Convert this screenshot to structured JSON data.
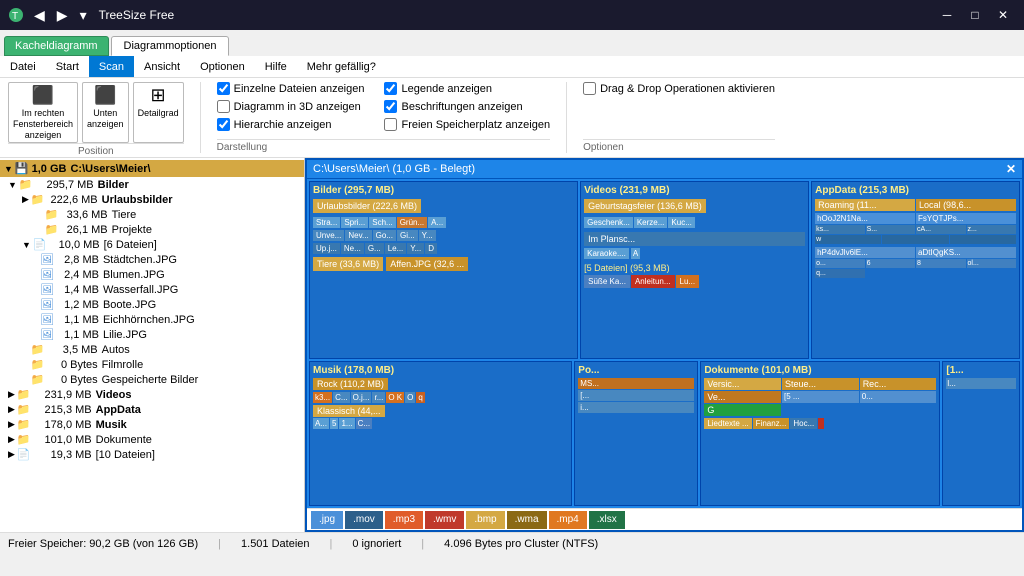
{
  "titlebar": {
    "title": "TreeSize Free",
    "back_btn": "◀",
    "forward_btn": "▶",
    "pin_btn": "📌",
    "minimize": "─",
    "maximize": "□",
    "close": "✕"
  },
  "tabs": {
    "kachel_label": "Kacheldiagramm",
    "diagramm_label": "Diagrammoptionen"
  },
  "menu": {
    "items": [
      "Datei",
      "Start",
      "Scan",
      "Ansicht",
      "Optionen",
      "Hilfe",
      "Mehr gefällig?"
    ]
  },
  "ribbon": {
    "darstellung_title": "Darstellung",
    "optionen_title": "Optionen",
    "position_title": "Position",
    "checkboxes_left": [
      {
        "label": "Einzelne Dateien anzeigen",
        "checked": true
      },
      {
        "label": "Diagramm in 3D anzeigen",
        "checked": false
      },
      {
        "label": "Hierarchie anzeigen",
        "checked": true
      }
    ],
    "checkboxes_right": [
      {
        "label": "Legende anzeigen",
        "checked": true
      },
      {
        "label": "Beschriftungen anzeigen",
        "checked": true
      },
      {
        "label": "Freien Speicherplatz anzeigen",
        "checked": false
      }
    ],
    "opt_checkbox": "Drag & Drop Operationen aktivieren",
    "btn_position1": "Im rechten\nFensterbereich\nanzeigen",
    "btn_position2": "Unten\nanzeigen",
    "btn_detail": "Detailgrad"
  },
  "tree": {
    "root_size": "1,0 GB",
    "root_path": "C:\\Users\\Meier\\",
    "items": [
      {
        "indent": 1,
        "size": "295,7 MB",
        "name": "Bilder",
        "bold": true,
        "has_children": true,
        "expanded": true
      },
      {
        "indent": 2,
        "size": "222,6 MB",
        "name": "Urlaubsbilder",
        "bold": true,
        "has_children": true,
        "expanded": false
      },
      {
        "indent": 3,
        "size": "33,6 MB",
        "name": "Tiere",
        "bold": false
      },
      {
        "indent": 3,
        "size": "26,1 MB",
        "name": "Projekte",
        "bold": false
      },
      {
        "indent": 2,
        "size": "10,0 MB",
        "name": "[6 Dateien]",
        "bold": false,
        "expanded": true,
        "has_children": true
      },
      {
        "indent": 3,
        "size": "2,8 MB",
        "name": "Städtchen.JPG",
        "is_file": true
      },
      {
        "indent": 3,
        "size": "2,4 MB",
        "name": "Blumen.JPG",
        "is_file": true
      },
      {
        "indent": 3,
        "size": "1,4 MB",
        "name": "Wasserfall.JPG",
        "is_file": true
      },
      {
        "indent": 3,
        "size": "1,2 MB",
        "name": "Boote.JPG",
        "is_file": true
      },
      {
        "indent": 3,
        "size": "1,1 MB",
        "name": "Eichhörnchen.JPG",
        "is_file": true
      },
      {
        "indent": 3,
        "size": "1,1 MB",
        "name": "Lilie.JPG",
        "is_file": true
      },
      {
        "indent": 2,
        "size": "3,5 MB",
        "name": "Autos",
        "bold": false
      },
      {
        "indent": 2,
        "size": "0 Bytes",
        "name": "Filmrolle",
        "bold": false
      },
      {
        "indent": 2,
        "size": "0 Bytes",
        "name": "Gespeicherte Bilder",
        "bold": false
      },
      {
        "indent": 1,
        "size": "231,9 MB",
        "name": "Videos",
        "bold": true
      },
      {
        "indent": 1,
        "size": "215,3 MB",
        "name": "AppData",
        "bold": true
      },
      {
        "indent": 1,
        "size": "178,0 MB",
        "name": "Musik",
        "bold": true
      },
      {
        "indent": 1,
        "size": "101,0 MB",
        "name": "Dokumente",
        "bold": false
      },
      {
        "indent": 1,
        "size": "19,3 MB",
        "name": "[10 Dateien]",
        "bold": false
      }
    ]
  },
  "tile_header": "C:\\Users\\Meier\\ (1,0 GB - Belegt)",
  "tile_sections": {
    "bilder": {
      "title": "Bilder (295,7 MB)",
      "sub": "Urlaubsbilder (222,6 MB)"
    },
    "videos": {
      "title": "Videos (231,9 MB)",
      "sub": "Geburtstagsfeier (136,6 MB)"
    },
    "appdata": {
      "title": "AppData (215,3 MB)"
    },
    "musik": {
      "title": "Musik (178,0 MB)",
      "sub": "Rock (110,2 MB)"
    },
    "dokumente": {
      "title": "Dokumente (101,0 MB)"
    }
  },
  "legend": {
    "items": [
      {
        "ext": ".jpg",
        "class": "legend-jpg"
      },
      {
        "ext": ".mov",
        "class": "legend-mov"
      },
      {
        "ext": ".mp3",
        "class": "legend-mp3"
      },
      {
        "ext": ".wmv",
        "class": "legend-wmv"
      },
      {
        "ext": ".bmp",
        "class": "legend-bmp"
      },
      {
        "ext": ".wma",
        "class": "legend-wma"
      },
      {
        "ext": ".mp4",
        "class": "legend-mp4"
      },
      {
        "ext": ".xlsx",
        "class": "legend-xlsx"
      }
    ]
  },
  "statusbar": {
    "free_space": "Freier Speicher: 90,2 GB (von 126 GB)",
    "files": "1.501 Dateien",
    "ignored": "0 ignoriert",
    "cluster": "4.096 Bytes pro Cluster (NTFS)"
  }
}
